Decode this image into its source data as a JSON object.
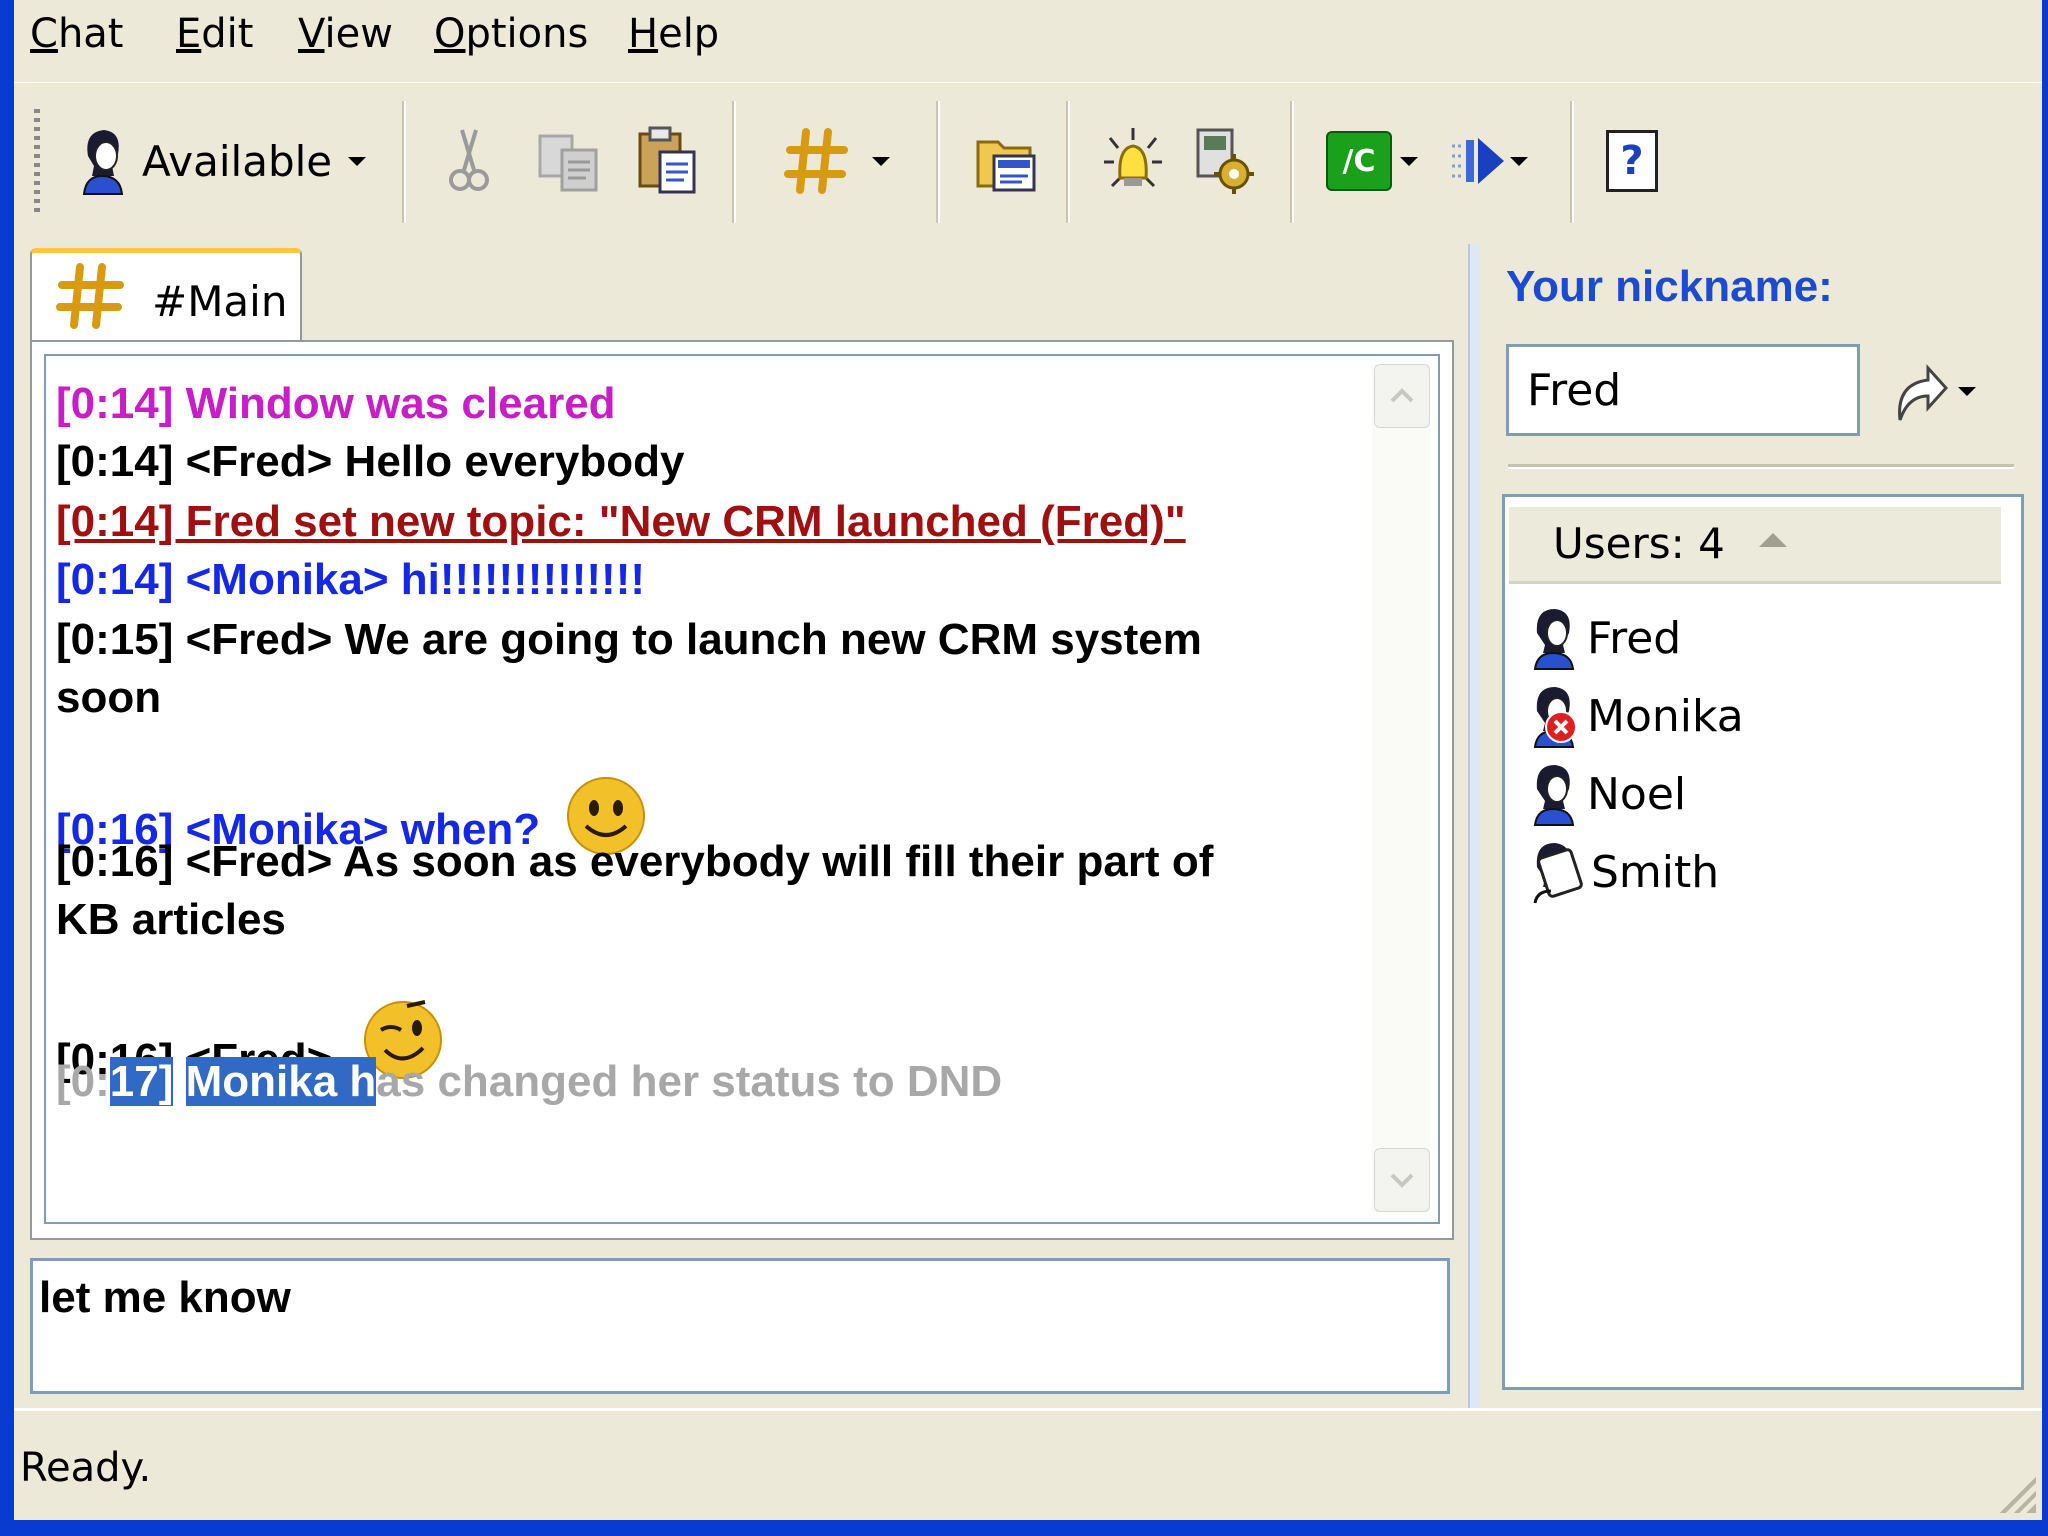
{
  "menu": [
    {
      "mnemonic": "C",
      "rest": "hat"
    },
    {
      "mnemonic": "E",
      "rest": "dit"
    },
    {
      "mnemonic": "V",
      "rest": "iew"
    },
    {
      "mnemonic": "O",
      "rest": "ptions"
    },
    {
      "mnemonic": "H",
      "rest": "elp"
    }
  ],
  "toolbar": {
    "status_label": "Available",
    "icons": [
      "user-status-icon",
      "cut-icon",
      "copy-icon",
      "paste-icon",
      "channel-icon",
      "open-folder-icon",
      "alert-icon",
      "settings-icon",
      "command-icon",
      "send-file-icon",
      "help-icon"
    ],
    "command_label": "/C",
    "help_label": "?"
  },
  "tab": {
    "label": "#Main"
  },
  "chat": {
    "messages": [
      {
        "type": "system",
        "text": "[0:14] Window was cleared"
      },
      {
        "type": "fred",
        "text": "[0:14] <Fred> Hello everybody"
      },
      {
        "type": "topic",
        "text": "[0:14] Fred set new topic: \"New CRM launched (Fred)\""
      },
      {
        "type": "monika",
        "text": "[0:14] <Monika> hi!!!!!!!!!!!!!!"
      },
      {
        "type": "fred",
        "text": "[0:15] <Fred> We are going to launch new CRM system"
      },
      {
        "type": "fred",
        "text": "soon"
      },
      {
        "type": "monika",
        "text": "[0:16] <Monika> when?"
      },
      {
        "type": "fred",
        "text": "[0:16] <Fred> As soon as everybody will fill their part of"
      },
      {
        "type": "fred",
        "text": "KB articles"
      },
      {
        "type": "fred",
        "text": "[0:16] <Fred>"
      }
    ],
    "status_msg": {
      "pre": "[0:",
      "sel1": "17]",
      "mid": " ",
      "sel2": "Monika h",
      "post": "as changed her status to DND"
    }
  },
  "input": {
    "value": "let me know"
  },
  "nick": {
    "label": "Your nickname:",
    "value": "Fred"
  },
  "users": {
    "header": "Users: 4",
    "list": [
      {
        "name": "Fred",
        "status": "available"
      },
      {
        "name": "Monika",
        "status": "dnd"
      },
      {
        "name": "Noel",
        "status": "available"
      },
      {
        "name": "Smith",
        "status": "away"
      }
    ]
  },
  "statusbar": {
    "text": "Ready."
  },
  "colors": {
    "system": "#c81ec8",
    "topic": "#a01010",
    "monika": "#1428e6",
    "status": "#a8a8a8",
    "nick_label": "#1a4bd0",
    "selection": "#316ac5"
  }
}
